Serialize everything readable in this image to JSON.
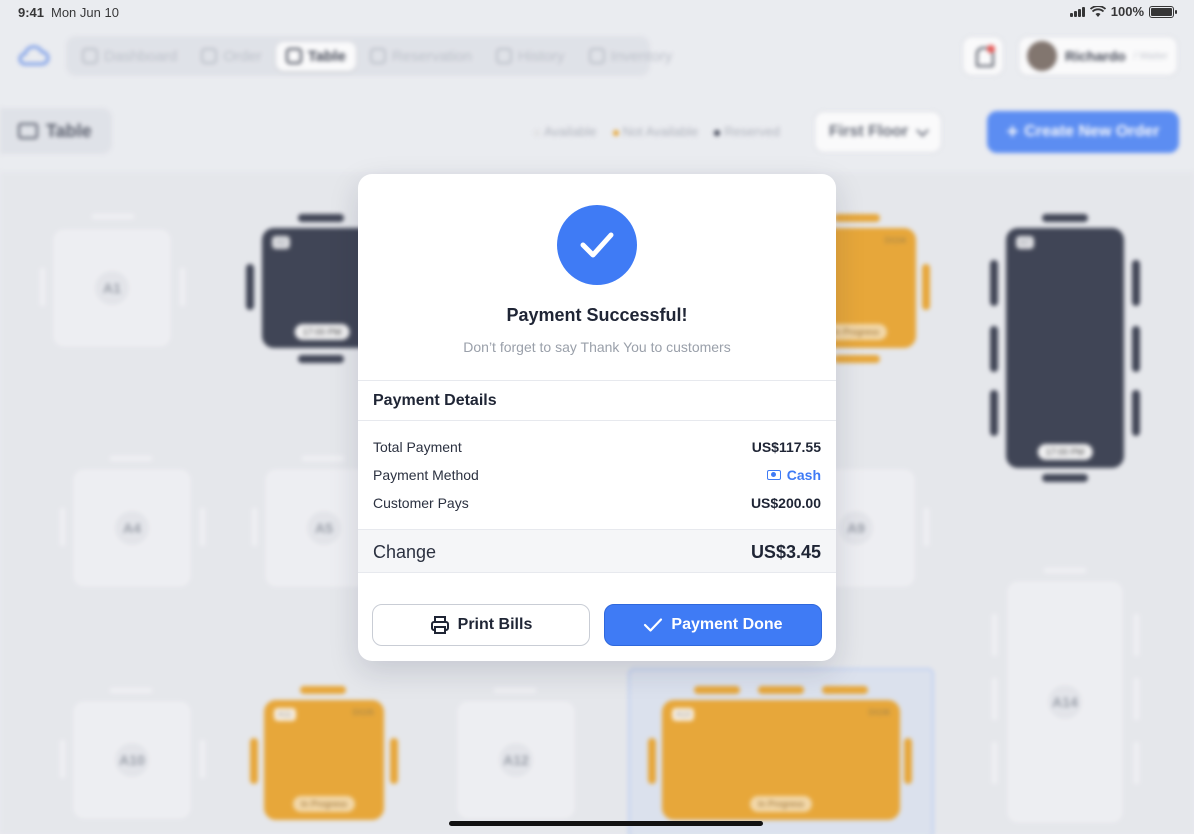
{
  "status_bar": {
    "time": "9:41",
    "date": "Mon Jun 10",
    "battery": "100%"
  },
  "nav": {
    "items": [
      {
        "label": "Dashboard",
        "icon": "dashboard-icon",
        "active": false
      },
      {
        "label": "Order",
        "icon": "order-icon",
        "active": false
      },
      {
        "label": "Table",
        "icon": "table-icon",
        "active": true
      },
      {
        "label": "Reservation",
        "icon": "calendar-icon",
        "active": false
      },
      {
        "label": "History",
        "icon": "clock-icon",
        "active": false
      },
      {
        "label": "Inventory",
        "icon": "inventory-icon",
        "active": false
      }
    ],
    "user_name": "Richardo",
    "user_role": "/ Waiter"
  },
  "toolbar": {
    "page_label": "Table",
    "legend_available": "Available",
    "legend_not_available": "Not Available",
    "legend_reserved": "Reserved",
    "floor": "First Floor",
    "create_label": "Create New Order"
  },
  "tables": [
    {
      "id": "A1",
      "status": "available"
    },
    {
      "id": "A2",
      "status": "reserved",
      "time": "17:00 PM"
    },
    {
      "id": "DI104",
      "status": "in-progress",
      "time": "In Progress"
    },
    {
      "id": "A7",
      "status": "reserved",
      "time": "17:00 PM"
    },
    {
      "id": "A4",
      "status": "available"
    },
    {
      "id": "A5",
      "status": "available"
    },
    {
      "id": "A9",
      "status": "available"
    },
    {
      "id": "A14",
      "status": "available"
    },
    {
      "id": "A10",
      "status": "available"
    },
    {
      "id": "A11",
      "order": "DI105",
      "status": "in-progress",
      "time": "In Progress"
    },
    {
      "id": "A12",
      "status": "available"
    },
    {
      "id": "A13",
      "order": "DI106",
      "status": "in-progress",
      "time": "In Progress"
    }
  ],
  "modal": {
    "title": "Payment Successful!",
    "subtitle": "Don’t forget to say Thank You to customers",
    "details_title": "Payment Details",
    "rows": [
      {
        "label": "Total Payment",
        "value": "US$117.55"
      },
      {
        "label": "Payment Method",
        "value": "Cash"
      },
      {
        "label": "Customer Pays",
        "value": "US$200.00"
      }
    ],
    "change_label": "Change",
    "change_value": "US$3.45",
    "print_label": "Print Bills",
    "done_label": "Payment Done"
  },
  "colors": {
    "accent": "#3f7bf5",
    "reserved": "#1d2336",
    "in_progress": "#e89a14",
    "available": "#f0f1f4"
  }
}
